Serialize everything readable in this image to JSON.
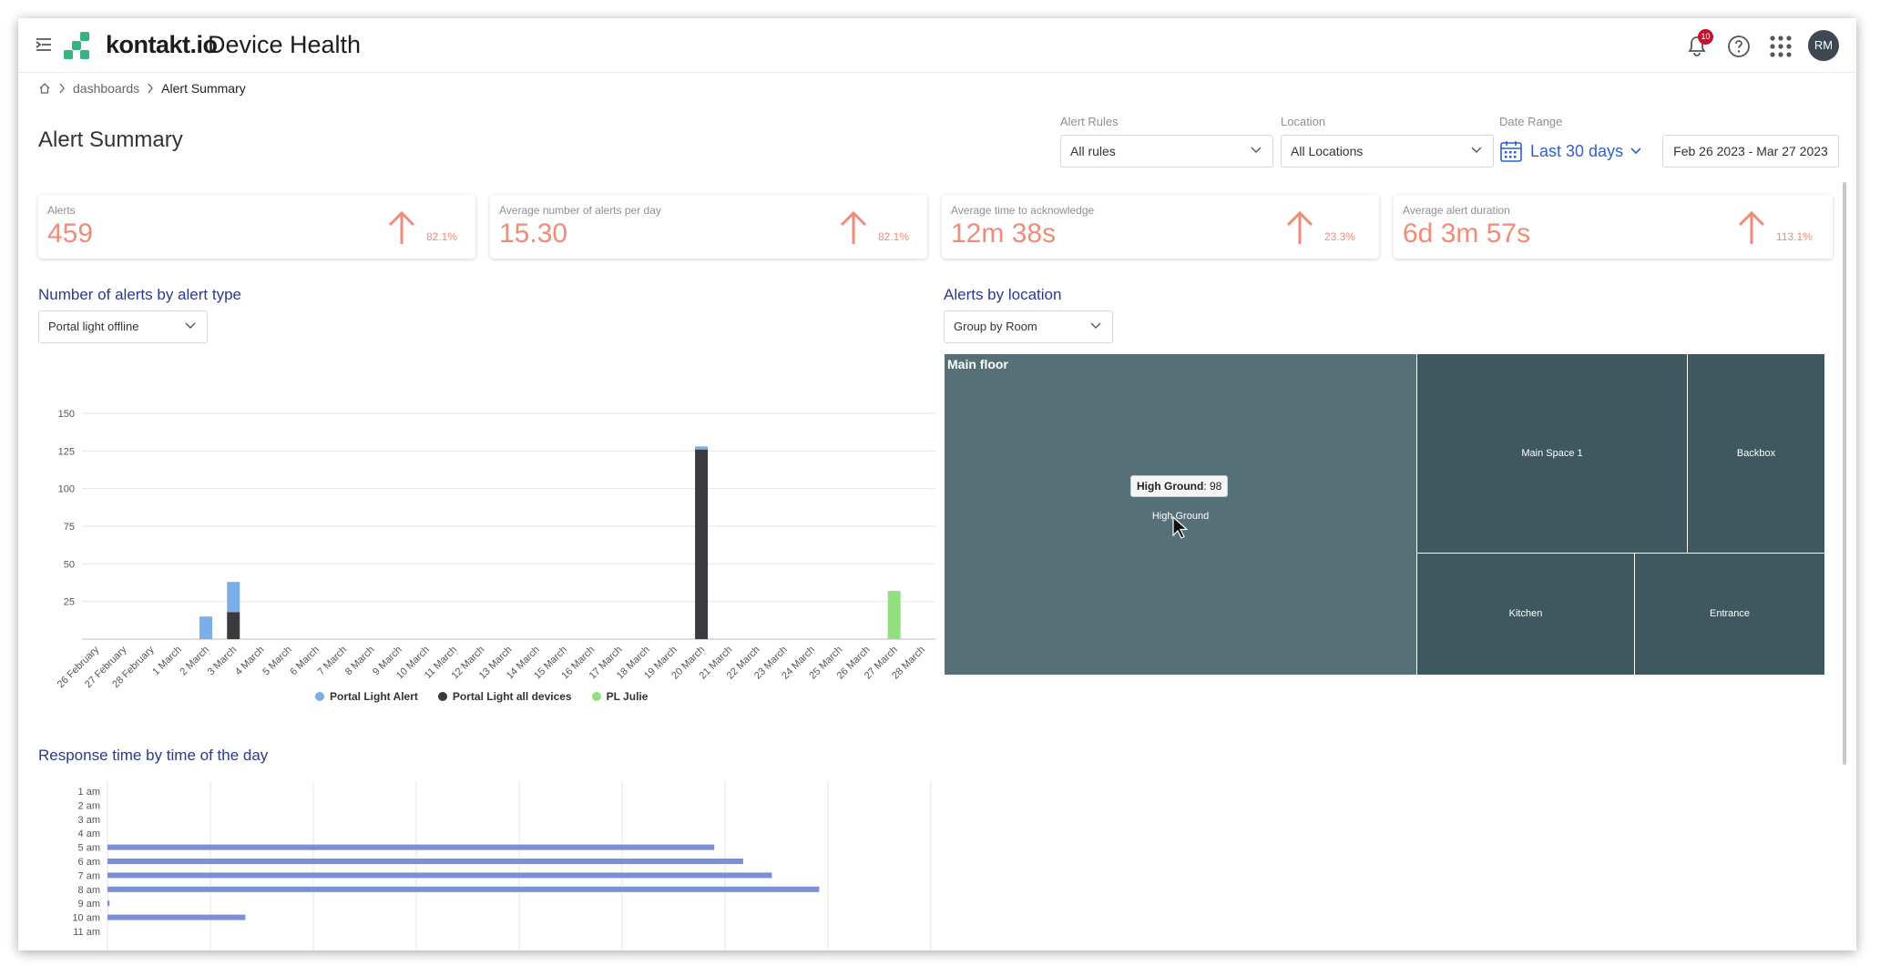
{
  "app": {
    "brand": "kontakt.io",
    "product": "Device Health",
    "notifications": "10",
    "avatar": "RM"
  },
  "breadcrumb": {
    "dashboards": "dashboards",
    "current": "Alert Summary"
  },
  "page": {
    "title": "Alert Summary"
  },
  "filters": {
    "alert_rules": {
      "label": "Alert Rules",
      "value": "All rules"
    },
    "location": {
      "label": "Location",
      "value": "All Locations"
    },
    "date_range": {
      "label": "Date Range",
      "preset": "Last 30 days",
      "value": "Feb 26 2023 - Mar 27 2023"
    }
  },
  "kpis": [
    {
      "label": "Alerts",
      "value": "459",
      "change": "82.1%"
    },
    {
      "label": "Average number of alerts per day",
      "value": "15.30",
      "change": "82.1%"
    },
    {
      "label": "Average time to acknowledge",
      "value": "12m 38s",
      "change": "23.3%"
    },
    {
      "label": "Average alert duration",
      "value": "6d 3m 57s",
      "change": "113.1%"
    }
  ],
  "alerts_by_type": {
    "title": "Number of alerts by alert type",
    "filter": "Portal light offline"
  },
  "alerts_by_location": {
    "title": "Alerts by location",
    "group": "Group by Room",
    "floor": "Main floor",
    "rooms": [
      "High Ground",
      "Main Space 1",
      "Backbox",
      "Kitchen",
      "Entrance"
    ],
    "tooltip": {
      "name": "High Ground",
      "value": ": 98"
    },
    "color": "#567078",
    "color_dark": "#3f5860"
  },
  "response_time": {
    "title": "Response time by time of the day"
  },
  "colors": {
    "accent": "#2b3a8c",
    "kpi": "#f28a78",
    "link": "#2f5fd0"
  },
  "chart_data": [
    {
      "type": "bar",
      "stacked": true,
      "categories": [
        "26 February",
        "27 February",
        "28 February",
        "1 March",
        "2 March",
        "3 March",
        "4 March",
        "5 March",
        "6 March",
        "7 March",
        "8 March",
        "9 March",
        "10 March",
        "11 March",
        "12 March",
        "13 March",
        "14 March",
        "15 March",
        "16 March",
        "17 March",
        "18 March",
        "19 March",
        "20 March",
        "21 March",
        "22 March",
        "23 March",
        "24 March",
        "25 March",
        "26 March",
        "27 March",
        "28 March"
      ],
      "yticks": [
        25,
        50,
        75,
        100,
        125,
        150
      ],
      "ylim": [
        0,
        150
      ],
      "series": [
        {
          "name": "Portal Light Alert",
          "color": "#7aaee8",
          "values": [
            0,
            0,
            0,
            0,
            15,
            20,
            0,
            0,
            0,
            0,
            0,
            0,
            0,
            0,
            0,
            0,
            0,
            0,
            0,
            0,
            0,
            0,
            2,
            0,
            0,
            0,
            0,
            0,
            0,
            0,
            0
          ]
        },
        {
          "name": "Portal Light all devices",
          "color": "#3b3b3f",
          "values": [
            0,
            0,
            0,
            0,
            0,
            18,
            0,
            0,
            0,
            0,
            0,
            0,
            0,
            0,
            0,
            0,
            0,
            0,
            0,
            0,
            0,
            0,
            126,
            0,
            0,
            0,
            0,
            0,
            0,
            0,
            0
          ]
        },
        {
          "name": "PL Julie",
          "color": "#90e07e",
          "values": [
            0,
            0,
            0,
            0,
            0,
            0,
            0,
            0,
            0,
            0,
            0,
            0,
            0,
            0,
            0,
            0,
            0,
            0,
            0,
            0,
            0,
            0,
            0,
            0,
            0,
            0,
            0,
            0,
            0,
            32,
            0
          ]
        }
      ]
    },
    {
      "type": "treemap",
      "values": [
        {
          "name": "High Ground",
          "value": 98
        },
        {
          "name": "Main Space 1",
          "value": 26
        },
        {
          "name": "Backbox",
          "value": 15
        },
        {
          "name": "Kitchen",
          "value": 17
        },
        {
          "name": "Entrance",
          "value": 12
        }
      ]
    },
    {
      "type": "bar",
      "orientation": "horizontal",
      "categories": [
        "1 am",
        "2 am",
        "3 am",
        "4 am",
        "5 am",
        "6 am",
        "7 am",
        "8 am",
        "9 am",
        "10 am",
        "11 am"
      ],
      "values": [
        0,
        0,
        0,
        0,
        590,
        618,
        646,
        692,
        2,
        134,
        0
      ],
      "xlim": [
        0,
        805
      ],
      "color": "#7a8fd6"
    }
  ]
}
